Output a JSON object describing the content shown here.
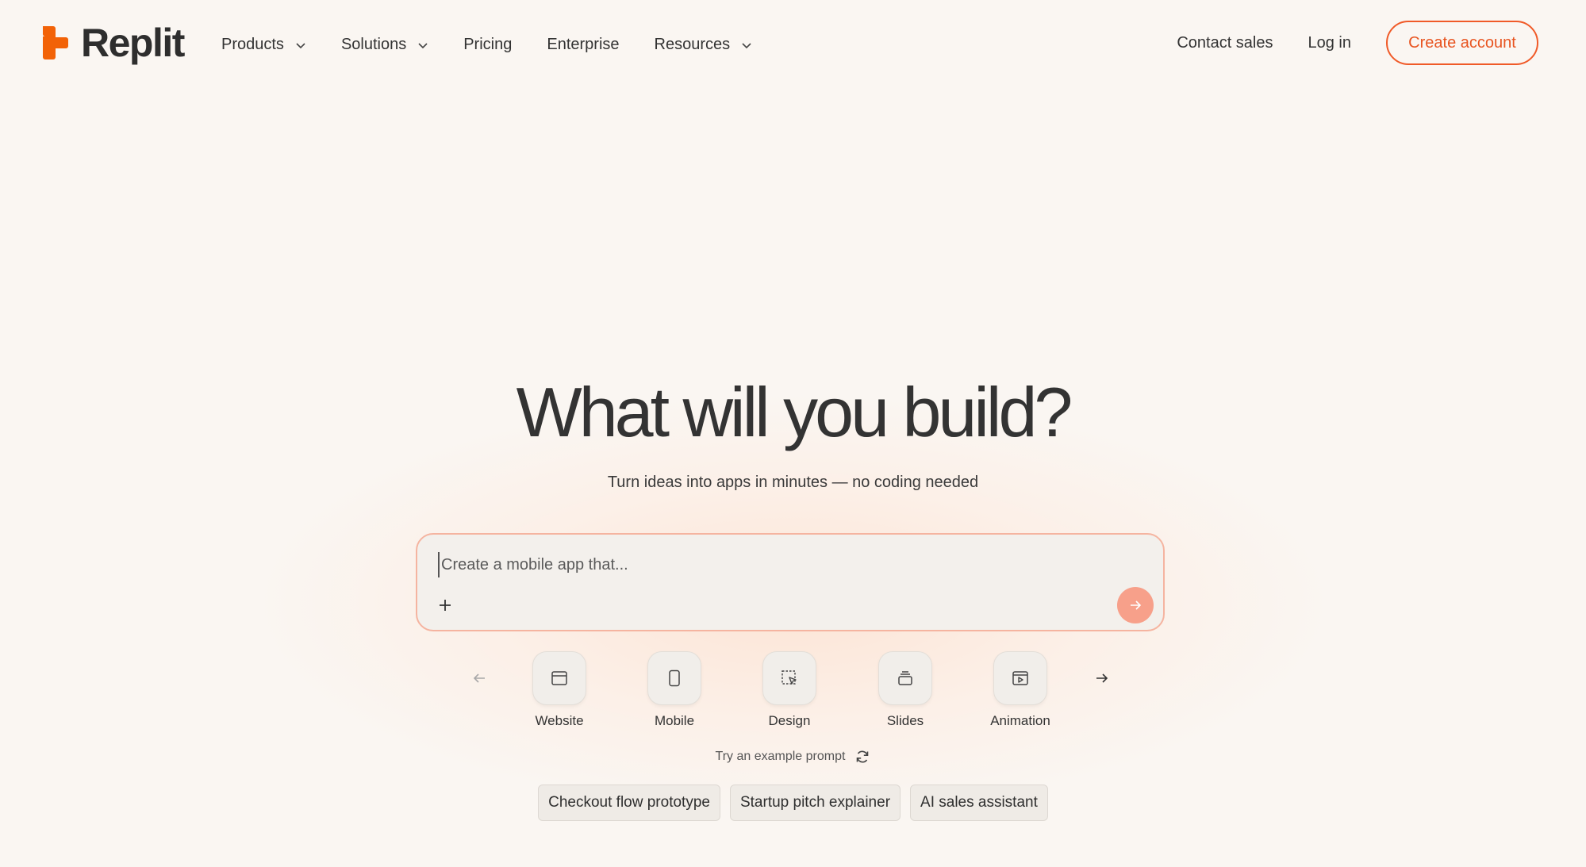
{
  "brand": {
    "name": "Replit",
    "color": "#f26207"
  },
  "nav": {
    "items": [
      {
        "label": "Products",
        "has_dropdown": true
      },
      {
        "label": "Solutions",
        "has_dropdown": true
      },
      {
        "label": "Pricing",
        "has_dropdown": false
      },
      {
        "label": "Enterprise",
        "has_dropdown": false
      },
      {
        "label": "Resources",
        "has_dropdown": true
      }
    ],
    "contact_sales": "Contact sales",
    "log_in": "Log in",
    "create_account": "Create account"
  },
  "hero": {
    "title": "What will you build?",
    "subtitle": "Turn ideas into apps in minutes — no coding needed"
  },
  "prompt": {
    "placeholder": "Create a mobile app that...",
    "value": "",
    "add_icon": "plus-icon",
    "send_icon": "arrow-right-icon"
  },
  "app_types": [
    {
      "label": "Website",
      "icon": "browser-window-icon"
    },
    {
      "label": "Mobile",
      "icon": "phone-icon"
    },
    {
      "label": "Design",
      "icon": "select-cursor-icon"
    },
    {
      "label": "Slides",
      "icon": "stacked-slides-icon"
    },
    {
      "label": "Animation",
      "icon": "play-window-icon"
    }
  ],
  "examples": {
    "heading": "Try an example prompt",
    "refresh_icon": "refresh-icon",
    "chips": [
      "Checkout flow prototype",
      "Startup pitch explainer",
      "AI sales assistant"
    ]
  },
  "colors": {
    "accent": "#f05a28",
    "background": "#faf6f2",
    "send_button": "#f7a08a",
    "prompt_border": "#f5b4a0"
  }
}
